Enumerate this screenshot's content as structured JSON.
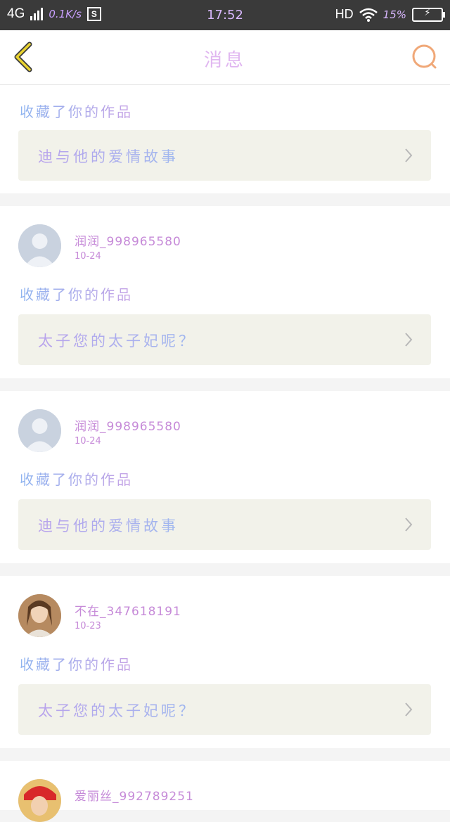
{
  "status_bar": {
    "network": "4G",
    "speed": "0.1K/s",
    "s_badge": "S",
    "time": "17:52",
    "hd": "HD",
    "battery_percent": "15%",
    "battery_level": 0.15
  },
  "nav": {
    "title": "消息",
    "back_icon": "chevron-left-icon",
    "search_icon": "search-icon"
  },
  "colors": {
    "accent_purple": "#c68ad8",
    "back_yellow": "#e8d230",
    "search_orange": "#f0a878",
    "card_bg": "#f2f2ea"
  },
  "messages": [
    {
      "action": "收藏了你的作品",
      "work_title": "迪与他的爱情故事"
    },
    {
      "username": "润润_998965580",
      "date": "10-24",
      "avatar": "default-avatar",
      "action": "收藏了你的作品",
      "work_title": "太子您的太子妃呢？"
    },
    {
      "username": "润润_998965580",
      "date": "10-24",
      "avatar": "default-avatar",
      "action": "收藏了你的作品",
      "work_title": "迪与他的爱情故事"
    },
    {
      "username": "不在_347618191",
      "date": "10-23",
      "avatar": "photo-avatar",
      "action": "收藏了你的作品",
      "work_title": "太子您的太子妃呢？"
    },
    {
      "username": "爱丽丝_992789251",
      "avatar": "photo-avatar-red"
    }
  ]
}
